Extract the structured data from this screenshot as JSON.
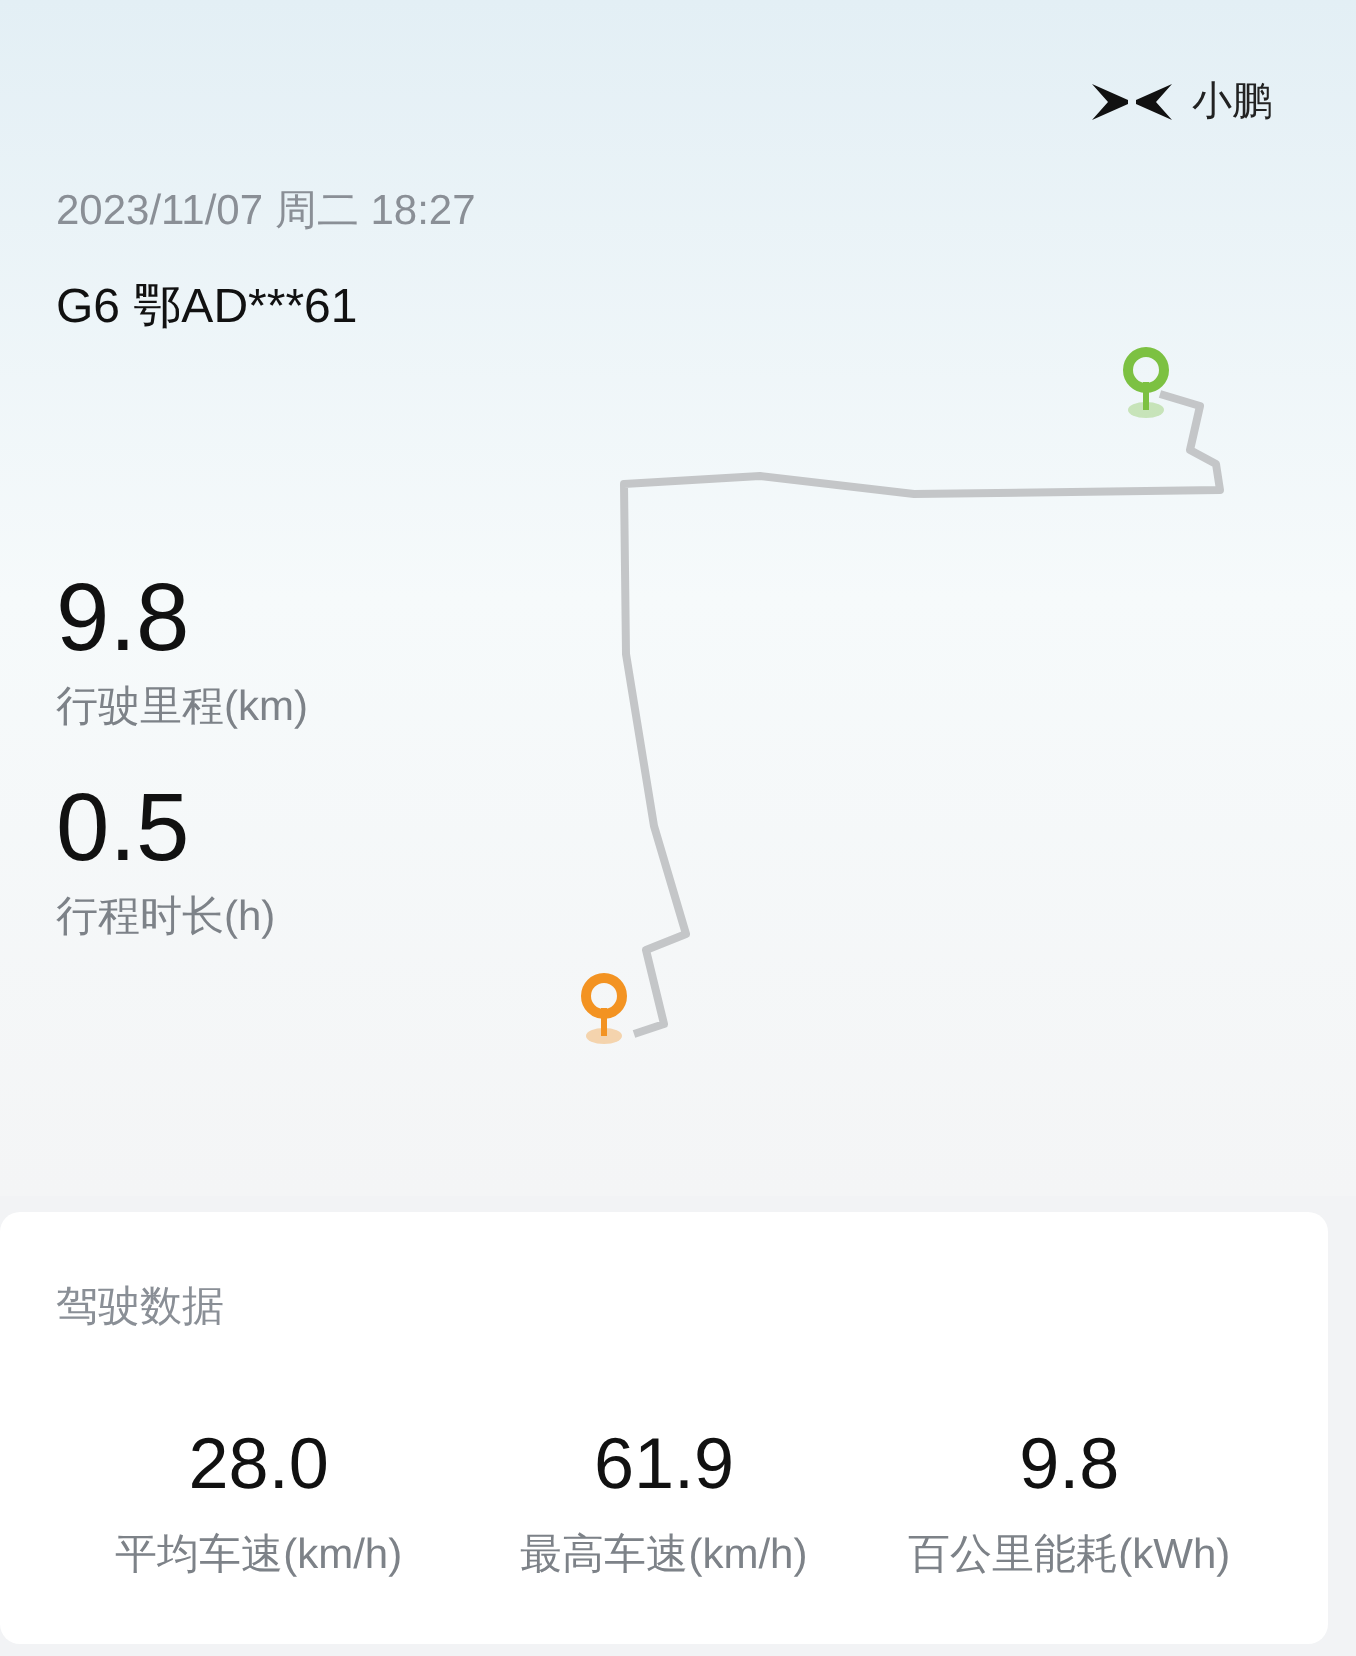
{
  "brand": {
    "name": "小鹏"
  },
  "trip": {
    "datetime": "2023/11/07 周二 18:27",
    "vehicle": "G6 鄂AD***61"
  },
  "metrics": [
    {
      "value": "9.8",
      "label": "行驶里程(km)"
    },
    {
      "value": "0.5",
      "label": "行程时长(h)"
    }
  ],
  "driving_data": {
    "title": "驾驶数据",
    "stats": [
      {
        "value": "28.0",
        "label": "平均车速(km/h)"
      },
      {
        "value": "61.9",
        "label": "最高车速(km/h)"
      },
      {
        "value": "9.8",
        "label": "百公里能耗(kWh)"
      }
    ]
  }
}
